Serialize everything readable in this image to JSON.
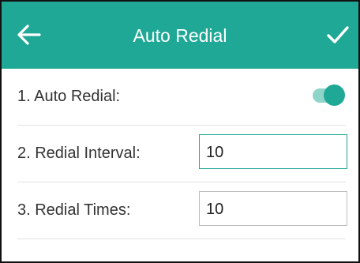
{
  "header": {
    "title": "Auto Redial",
    "back_icon": "arrow-left-icon",
    "confirm_icon": "checkmark-icon",
    "background": "#20a896"
  },
  "settings": {
    "auto_redial": {
      "label": "1. Auto Redial:",
      "enabled": true
    },
    "redial_interval": {
      "label": "2. Redial Interval:",
      "value": "10"
    },
    "redial_times": {
      "label": "3. Redial Times:",
      "value": "10"
    }
  },
  "colors": {
    "accent": "#20a896",
    "toggle_track": "#8fd5c9",
    "divider": "#e1e1e1"
  }
}
